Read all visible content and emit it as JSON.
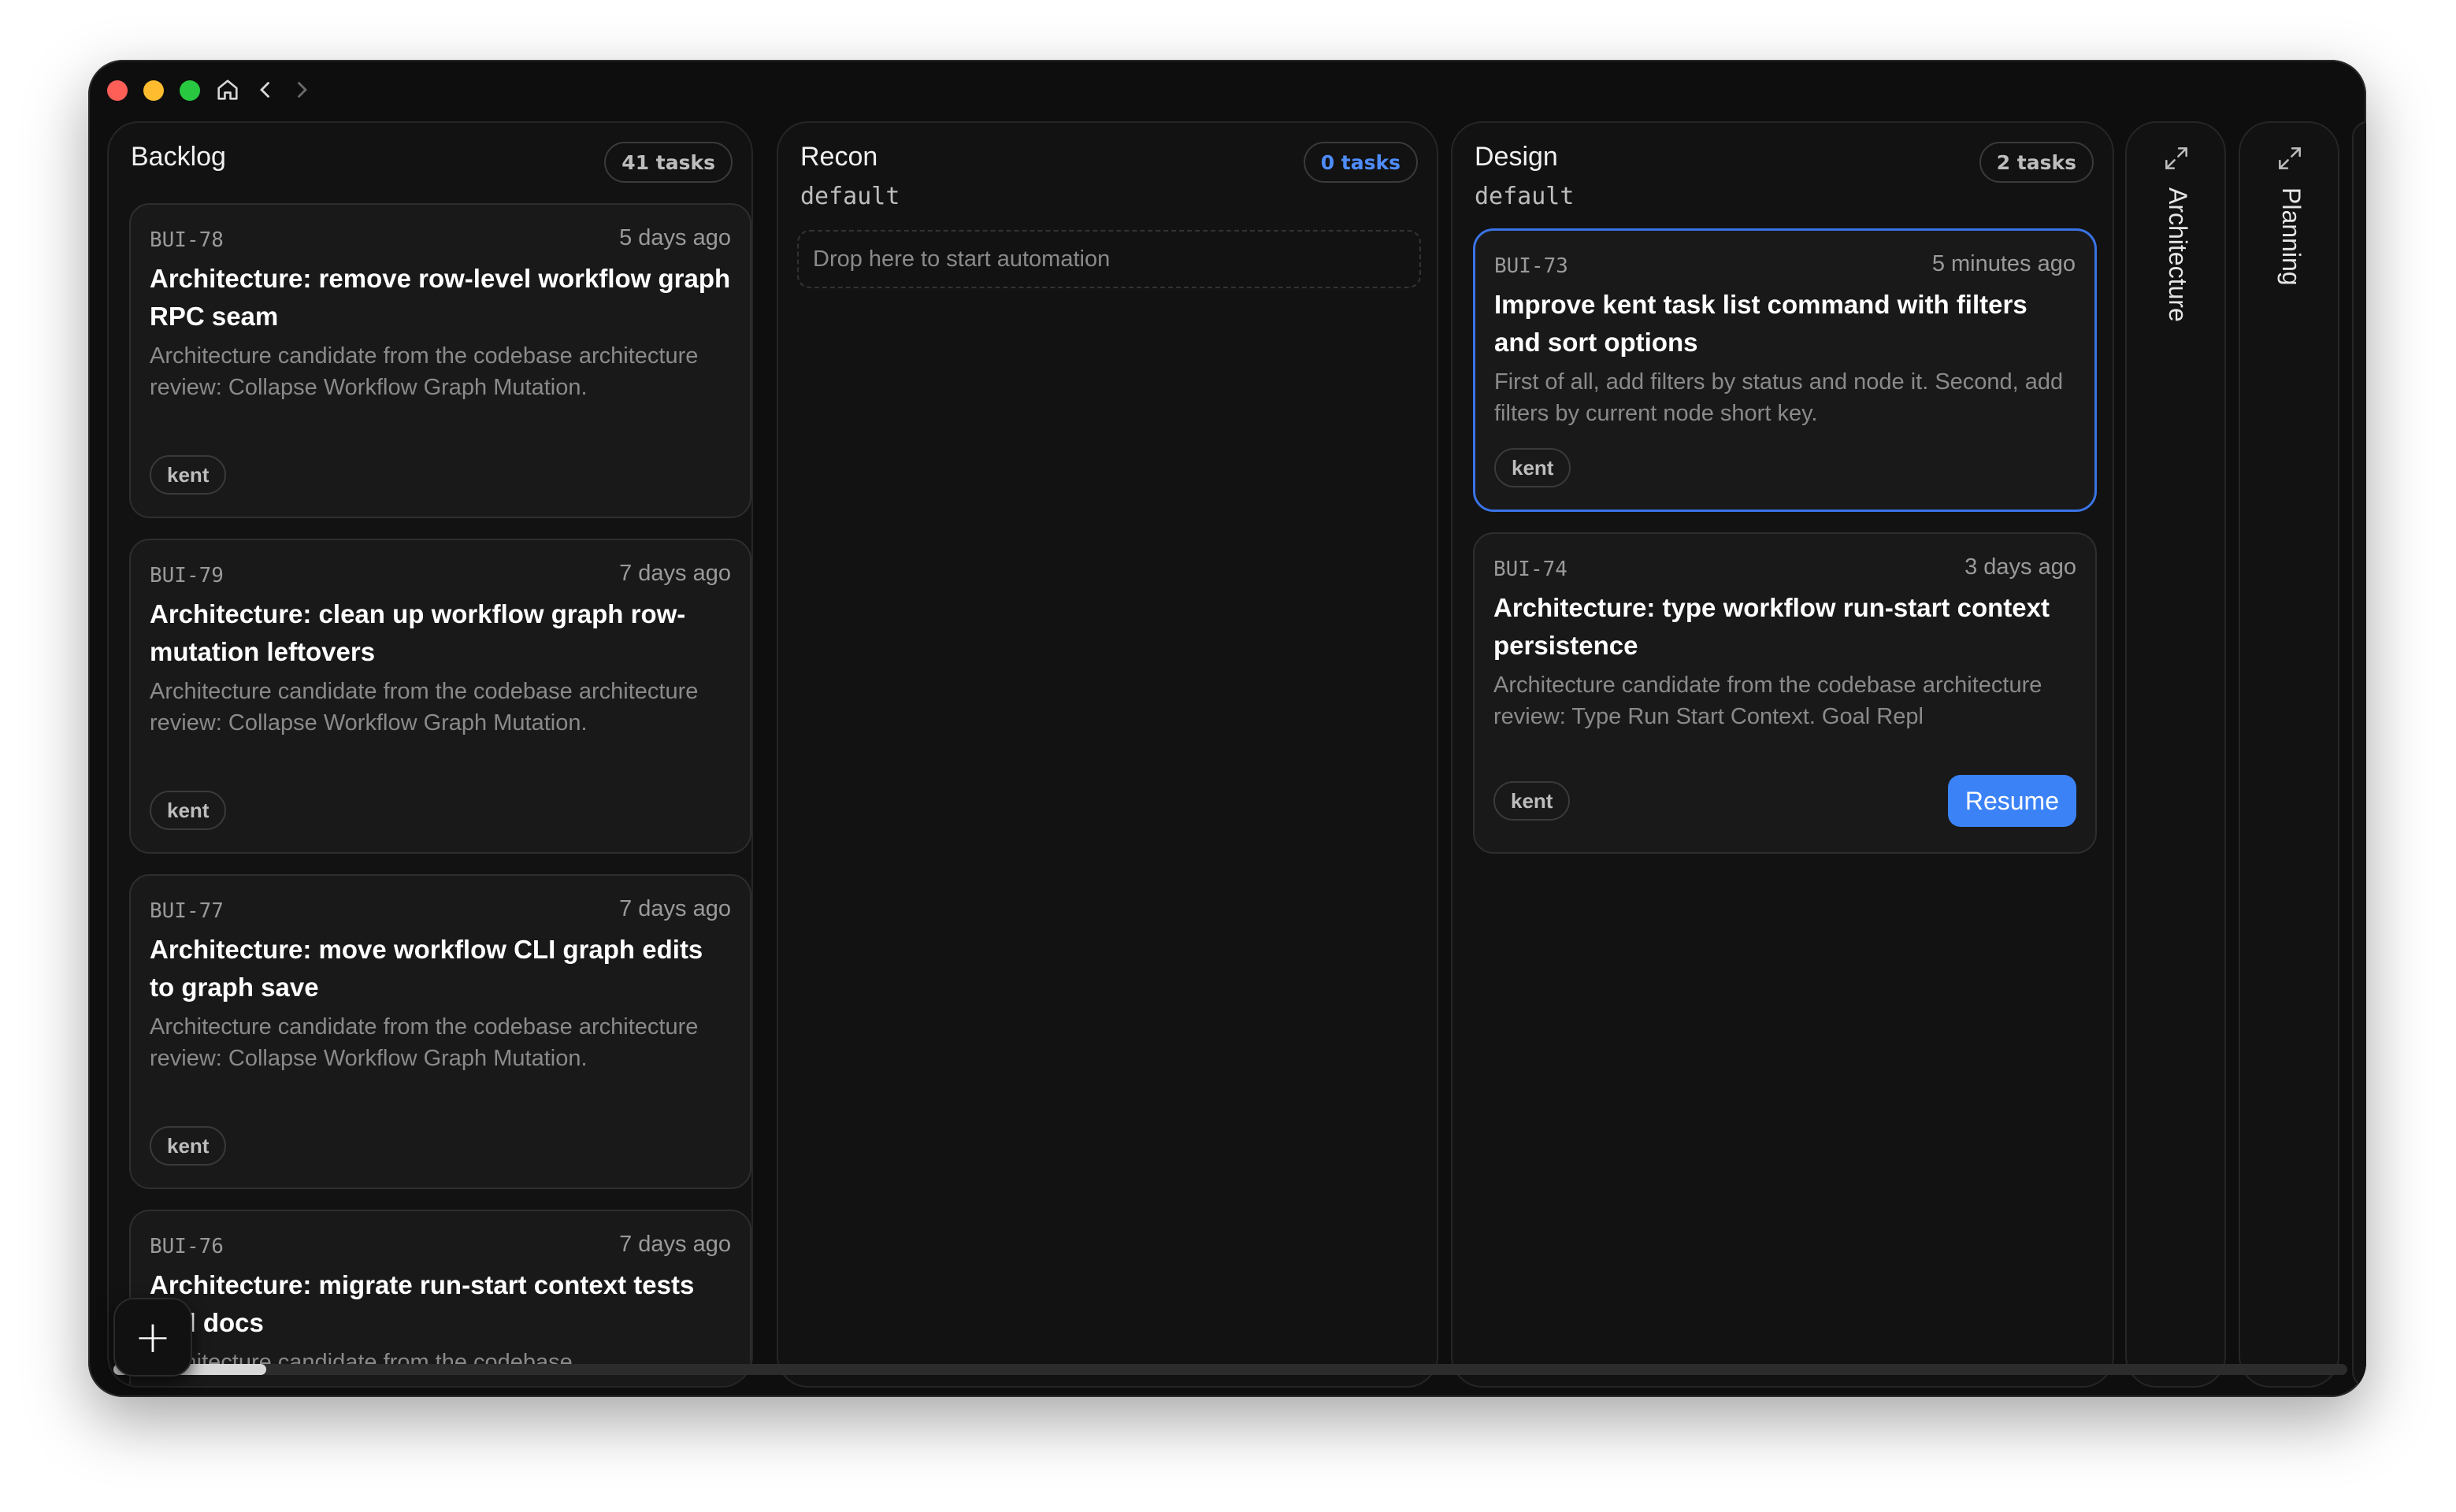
{
  "window": {
    "controls": [
      "close",
      "minimize",
      "maximize"
    ],
    "nav_icons": [
      "home-icon",
      "chevron-left-icon",
      "chevron-right-icon"
    ]
  },
  "columns": {
    "backlog": {
      "title": "Backlog",
      "count": "41 tasks",
      "cards": [
        {
          "id": "BUI-78",
          "time": "5 days ago",
          "title": "Architecture: remove row-level workflow graph RPC seam",
          "description": "Architecture candidate from the codebase architecture review: Collapse Workflow Graph Mutation.",
          "tag": "kent"
        },
        {
          "id": "BUI-79",
          "time": "7 days ago",
          "title": "Architecture: clean up workflow graph row-mutation leftovers",
          "description": "Architecture candidate from the codebase architecture review: Collapse Workflow Graph Mutation.",
          "tag": "kent"
        },
        {
          "id": "BUI-77",
          "time": "7 days ago",
          "title": "Architecture: move workflow CLI graph edits to graph save",
          "description": "Architecture candidate from the codebase architecture review: Collapse Workflow Graph Mutation.",
          "tag": "kent"
        },
        {
          "id": "BUI-76",
          "time": "7 days ago",
          "title": "Architecture: migrate run-start context tests and docs",
          "description": "Architecture candidate from the codebase"
        }
      ]
    },
    "recon": {
      "title": "Recon",
      "subtitle": "default",
      "count": "0 tasks",
      "dropzone": "Drop here to start automation"
    },
    "design": {
      "title": "Design",
      "subtitle": "default",
      "count": "2 tasks",
      "cards": [
        {
          "id": "BUI-73",
          "time": "5 minutes ago",
          "title": "Improve kent task list command with filters and sort options",
          "description": "First of all, add filters by status and node it. Second, add filters by current node short key.",
          "tag": "kent"
        },
        {
          "id": "BUI-74",
          "time": "3 days ago",
          "title": "Architecture: type workflow run-start context persistence",
          "description": "Architecture candidate from the codebase architecture review: Type Run Start Context. Goal Repl",
          "tag": "kent",
          "action": "Resume"
        }
      ]
    },
    "architecture": {
      "title": "Architecture"
    },
    "planning": {
      "title": "Planning"
    }
  },
  "fab": {
    "label": "+"
  },
  "colors": {
    "background": "#0e0e0e",
    "accent": "#3b82f6",
    "selected_border": "#3a73e6",
    "text_primary": "#ffffff",
    "text_muted": "#8a8a8a"
  }
}
